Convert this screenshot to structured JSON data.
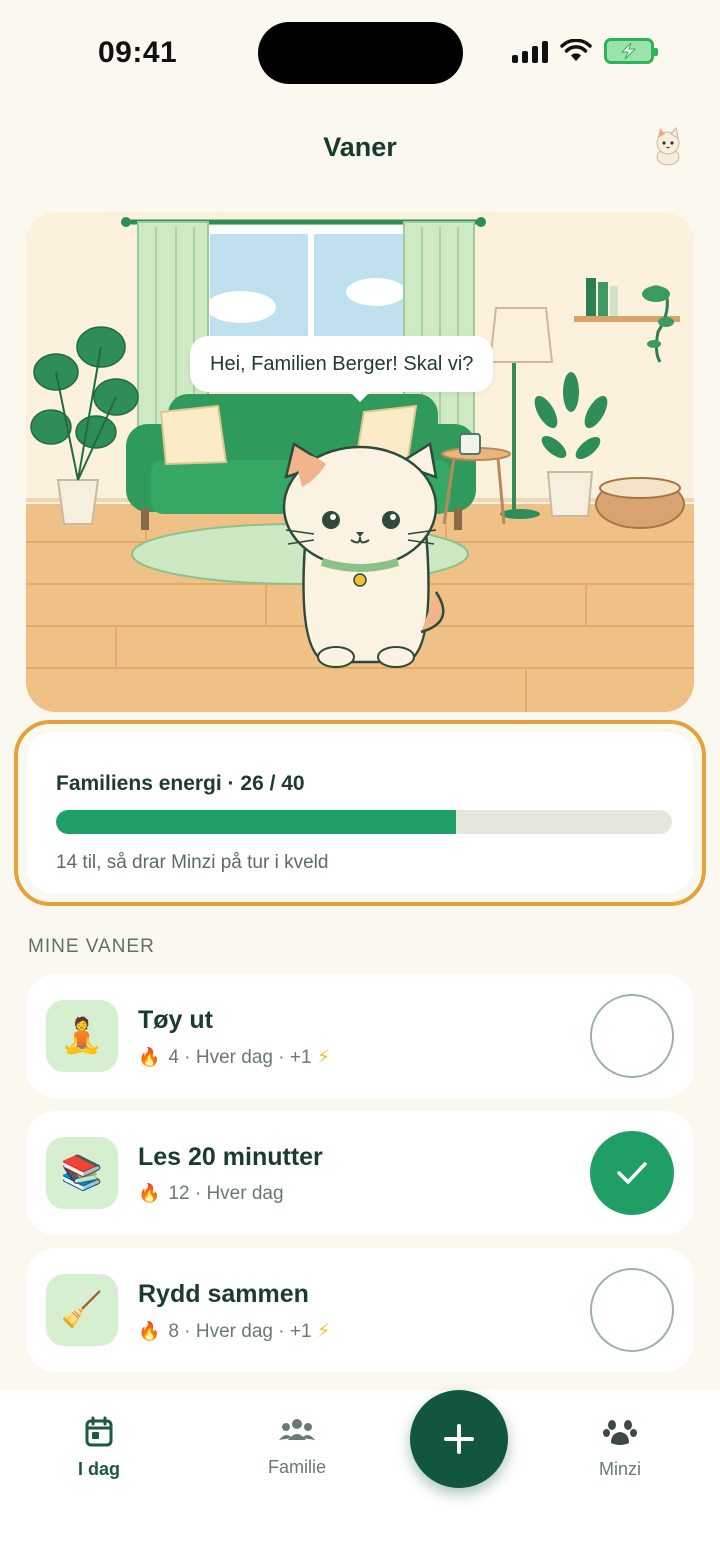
{
  "status_bar": {
    "time": "09:41"
  },
  "header": {
    "title": "Vaner",
    "avatar_icon": "cat-avatar-icon"
  },
  "scene": {
    "speech_bubble": "Hei, Familien Berger! Skal vi?"
  },
  "energy": {
    "title": "Familiens energi · 26 / 40",
    "current": 26,
    "max": 40,
    "subtitle": "14 til, så drar Minzi på tur i kveld"
  },
  "section": {
    "label": "MINE VANER"
  },
  "habits": [
    {
      "title": "Tøy ut",
      "icon": "🧘",
      "streak": "4",
      "meta": "Hver dag · +1",
      "bonus": "⚡",
      "done": false
    },
    {
      "title": "Les 20 minutter",
      "icon": "📚",
      "streak": "12",
      "meta": "Hver dag",
      "bonus": "",
      "done": true
    },
    {
      "title": "Rydd sammen",
      "icon": "🧹",
      "streak": "8",
      "meta": "Hver dag · +1",
      "bonus": "⚡",
      "done": false
    }
  ],
  "tabbar": {
    "today": "I dag",
    "family": "Familie",
    "minzi": "Minzi"
  },
  "colors": {
    "accent": "#1f9e66",
    "dark_green": "#12573d",
    "highlight": "#e3a23a"
  }
}
